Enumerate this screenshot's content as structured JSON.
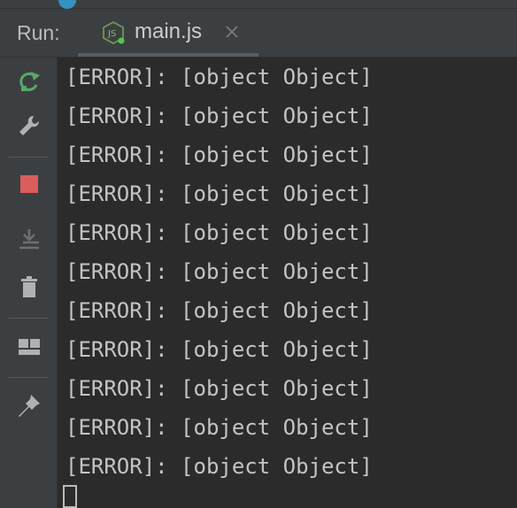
{
  "run_panel": {
    "label": "Run:",
    "tab": {
      "title": "main.js",
      "icon": "nodejs-icon",
      "close_icon": "close-icon"
    }
  },
  "toolbar": {
    "items": [
      {
        "name": "rerun-icon",
        "color": "#59a869"
      },
      {
        "name": "wrench-icon",
        "color": "#afb1b3"
      },
      {
        "name": "stop-icon",
        "color": "#db5c5c"
      },
      {
        "name": "scroll-to-end-icon",
        "color": "#6e7072"
      },
      {
        "name": "trash-icon",
        "color": "#afb1b3"
      },
      {
        "name": "layout-icon",
        "color": "#afb1b3"
      },
      {
        "name": "pin-icon",
        "color": "#afb1b3"
      }
    ]
  },
  "console": {
    "lines": [
      "[ERROR]: [object Object]",
      "[ERROR]: [object Object]",
      "[ERROR]: [object Object]",
      "[ERROR]: [object Object]",
      "[ERROR]: [object Object]",
      "[ERROR]: [object Object]",
      "[ERROR]: [object Object]",
      "[ERROR]: [object Object]",
      "[ERROR]: [object Object]",
      "[ERROR]: [object Object]",
      "[ERROR]: [object Object]"
    ]
  },
  "colors": {
    "background": "#2b2b2b",
    "panel": "#3c3f41",
    "text": "#c4c4c4",
    "node_green": "#59a869",
    "stop_red": "#db5c5c"
  }
}
